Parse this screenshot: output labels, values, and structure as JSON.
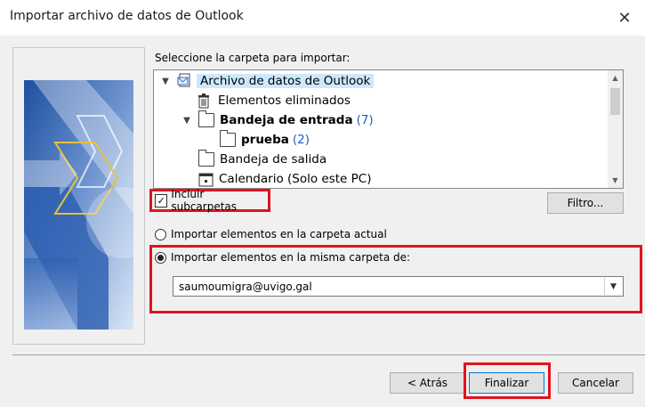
{
  "window": {
    "title": "Importar archivo de datos de Outlook",
    "close_glyph": "✕"
  },
  "select_label": "Seleccione la carpeta para importar:",
  "tree": [
    {
      "label": "Archivo de datos de Outlook",
      "expander": "▼",
      "icon": "pst-file-icon",
      "selected": true
    },
    {
      "label": "Elementos eliminados",
      "expander": "",
      "icon": "trash-icon"
    },
    {
      "label": "Bandeja de entrada",
      "count": "(7)",
      "expander": "▼",
      "icon": "folder-icon",
      "bold": true
    },
    {
      "label": "prueba",
      "count": "(2)",
      "expander": "",
      "icon": "folder-icon",
      "bold": true
    },
    {
      "label": "Bandeja de salida",
      "expander": "",
      "icon": "folder-icon"
    },
    {
      "label": "Calendario (Solo este PC)",
      "expander": "",
      "icon": "calendar-icon"
    }
  ],
  "include_subfolders": {
    "label": "Incluir subcarpetas",
    "checked": true,
    "check_glyph": "✓"
  },
  "filter_button": "Filtro...",
  "radio_current": {
    "label": "Importar elementos en la carpeta actual",
    "selected": false
  },
  "radio_same": {
    "label": "Importar elementos en la misma carpeta de:",
    "selected": true
  },
  "account_combo": {
    "value": "saumoumigra@uvigo.gal",
    "arrow": "▼"
  },
  "scroll": {
    "up": "▲",
    "down": "▼"
  },
  "buttons": {
    "back": "< Atrás",
    "finish": "Finalizar",
    "cancel": "Cancelar"
  },
  "colors": {
    "highlight_red": "#e0141e",
    "selection": "#cce8ff",
    "count_blue": "#1f5cc4"
  }
}
